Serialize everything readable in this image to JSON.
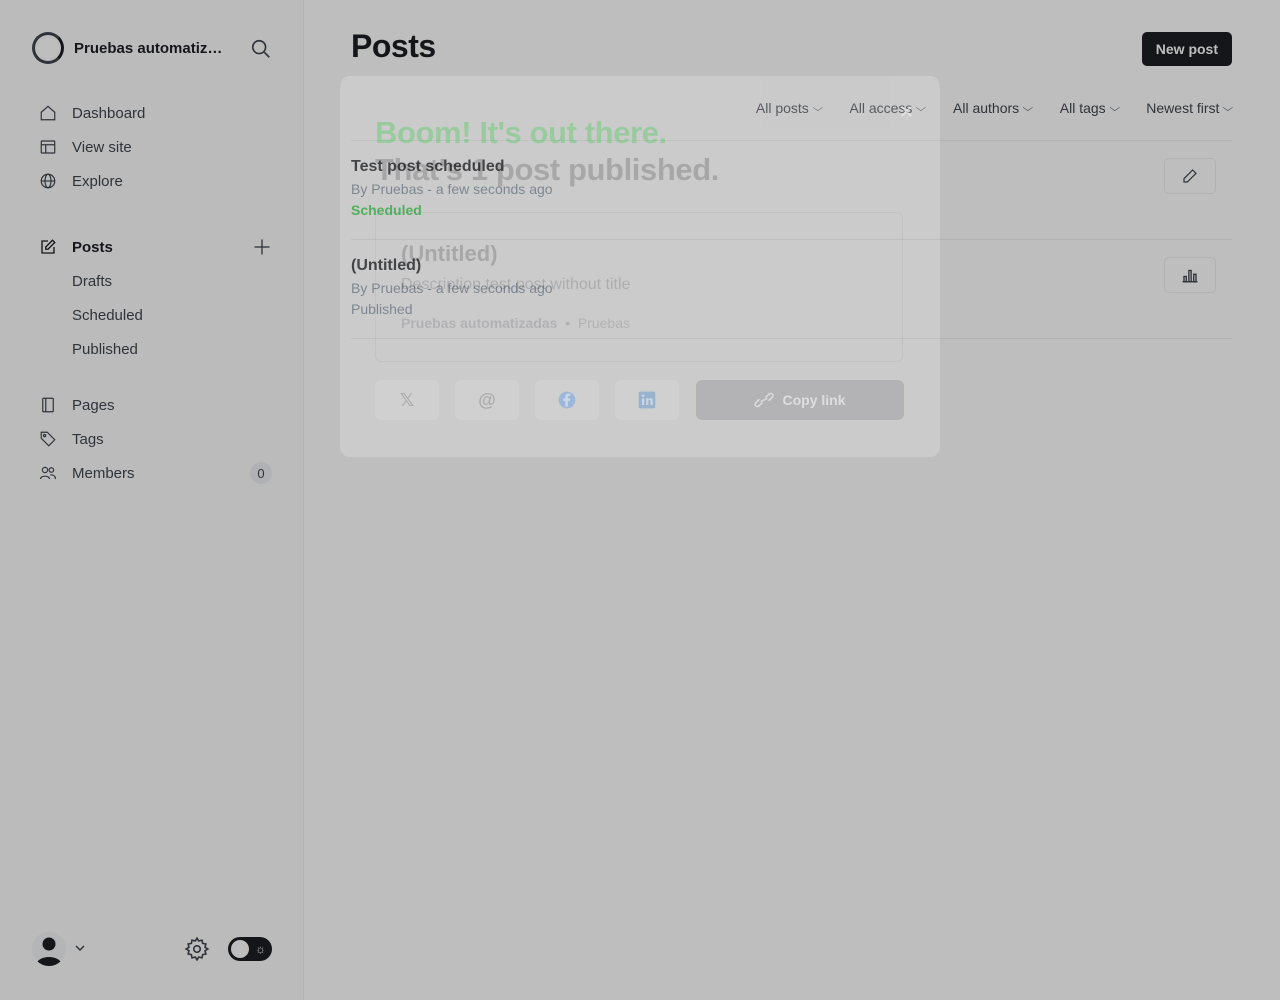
{
  "sidebar": {
    "site_title": "Pruebas automatizadas",
    "nav_primary": [
      {
        "label": "Dashboard",
        "icon": "home-icon"
      },
      {
        "label": "View site",
        "icon": "layout-icon"
      },
      {
        "label": "Explore",
        "icon": "globe-icon"
      }
    ],
    "posts": {
      "label": "Posts",
      "subitems": [
        "Drafts",
        "Scheduled",
        "Published"
      ]
    },
    "nav_secondary": [
      {
        "label": "Pages",
        "icon": "pages-icon"
      },
      {
        "label": "Tags",
        "icon": "tag-icon"
      },
      {
        "label": "Members",
        "icon": "members-icon",
        "count": "0"
      }
    ]
  },
  "header": {
    "title": "Posts",
    "new_post_label": "New post"
  },
  "filters": [
    "All posts",
    "All access",
    "All authors",
    "All tags",
    "Newest first"
  ],
  "posts": [
    {
      "title": "Test post scheduled",
      "meta": "By Pruebas - a few seconds ago",
      "status": "Scheduled",
      "action_icon": "pencil-icon"
    },
    {
      "title": "(Untitled)",
      "meta": "By Pruebas - a few seconds ago",
      "status": "Published",
      "action_icon": "analytics-icon"
    }
  ],
  "modal": {
    "headline_green": "Boom! It's out there.",
    "headline_dark": "That's 1 post published.",
    "card_title": "(Untitled)",
    "card_excerpt": "Description test post without title",
    "card_site": "Pruebas automatizadas",
    "card_author": "Pruebas",
    "copy_link_label": "Copy link",
    "share_icons": [
      "x-icon",
      "threads-icon",
      "facebook-icon",
      "linkedin-icon"
    ]
  },
  "colors": {
    "accent_green": "#30cf43",
    "dark": "#15171a"
  }
}
